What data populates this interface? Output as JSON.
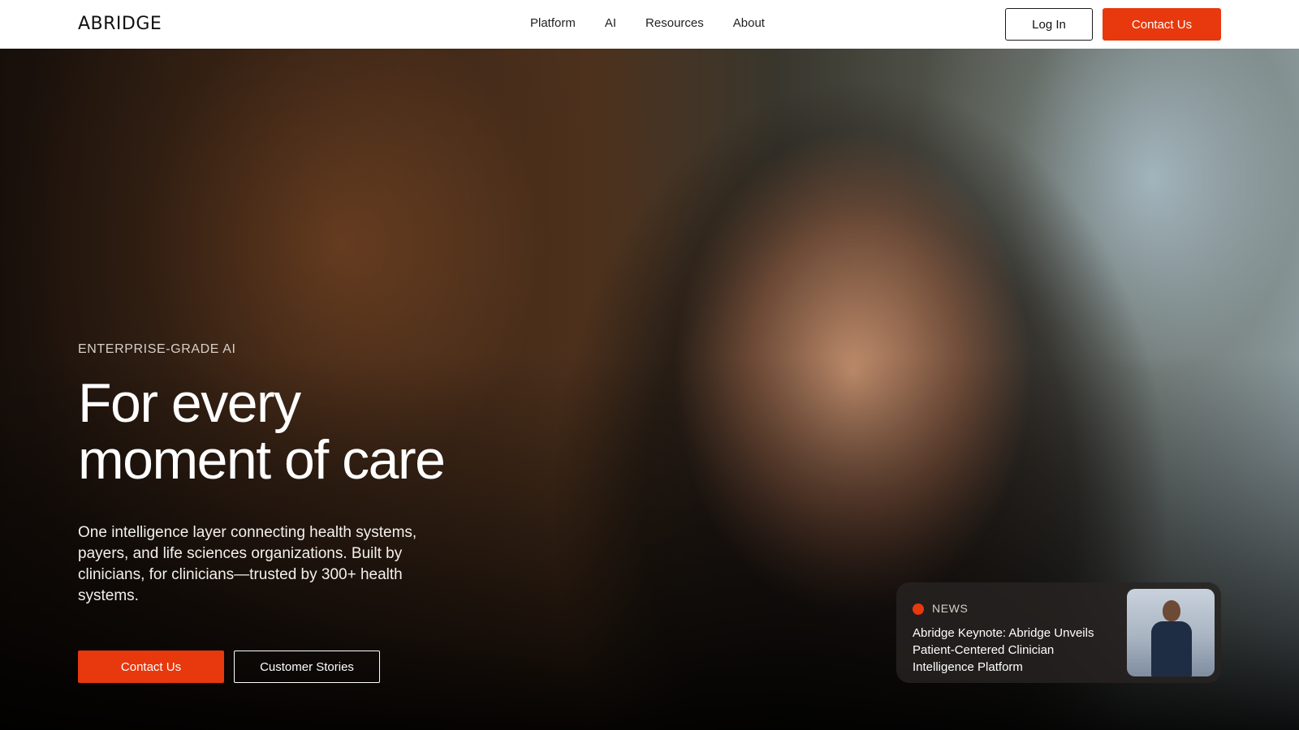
{
  "header": {
    "logo": "ABRIDGE",
    "nav": [
      "Platform",
      "AI",
      "Resources",
      "About"
    ],
    "login_label": "Log In",
    "contact_label": "Contact Us"
  },
  "hero": {
    "eyebrow": "ENTERPRISE-GRADE AI",
    "headline_line1": "For every",
    "headline_line2": "moment of care",
    "description": "One intelligence layer connecting health systems, payers, and life sciences organizations. Built by clinicians, for clinicians—trusted by 300+ health systems.",
    "primary_button": "Contact Us",
    "secondary_button": "Customer Stories"
  },
  "news": {
    "tag": "NEWS",
    "title": "Abridge Keynote: Abridge Unveils Patient-Centered Clinician Intelligence Platform"
  },
  "colors": {
    "accent": "#e8380d",
    "header_bg": "#ffffff"
  }
}
